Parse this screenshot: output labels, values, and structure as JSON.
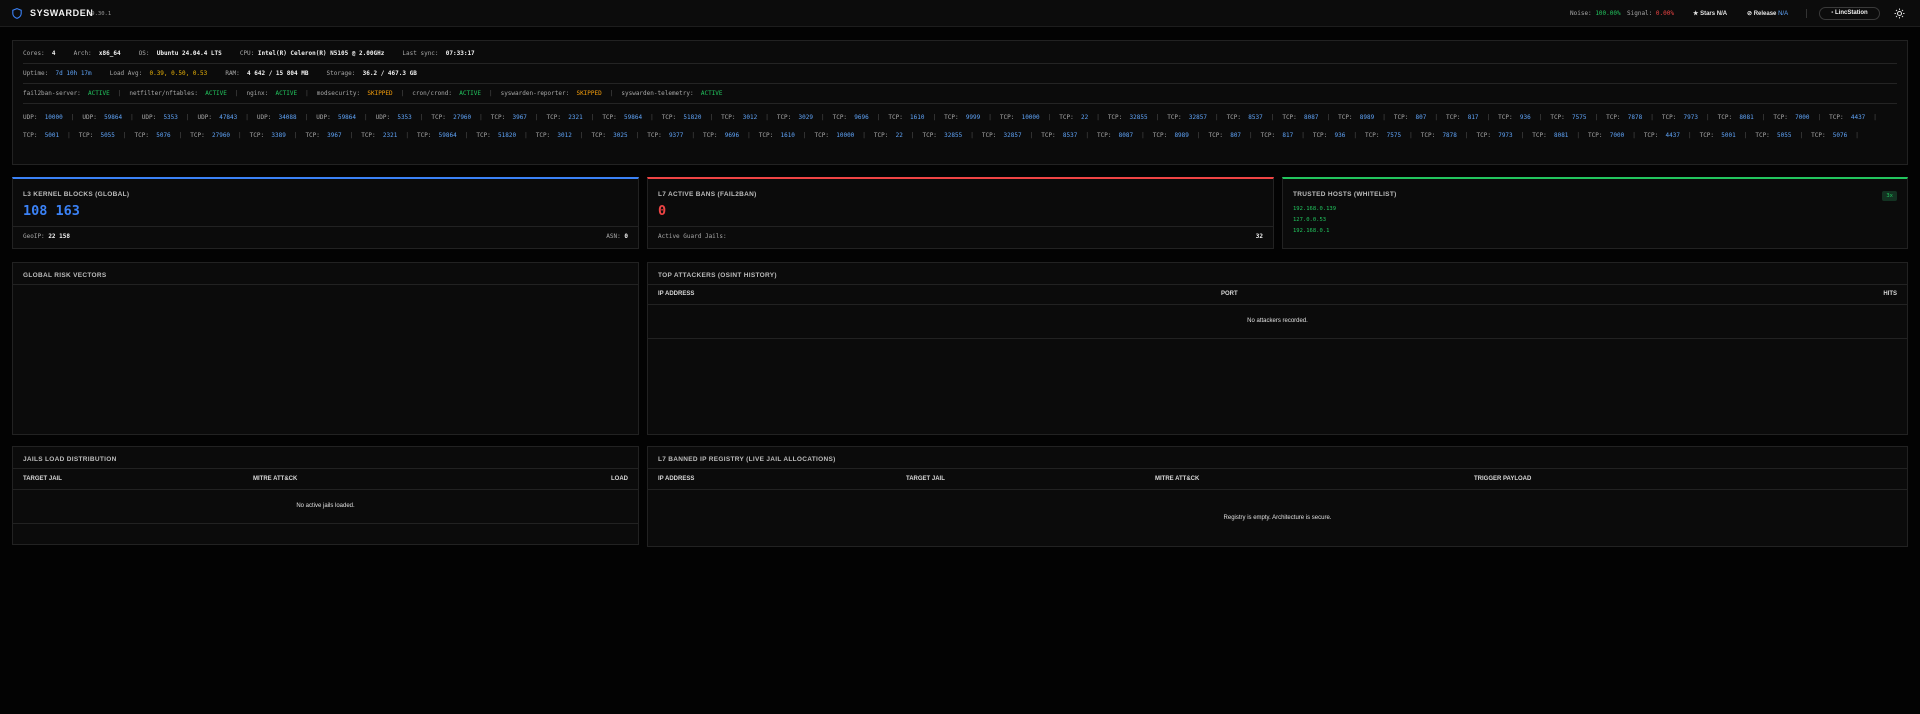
{
  "header": {
    "brand": "SYSWARDEN",
    "version": "v9.30.1",
    "noise_label": "Noise:",
    "noise_value": "100.00%",
    "signal_label": "Signal:",
    "signal_value": "0.00%",
    "stars_label": "Stars",
    "stars_value": "N/A",
    "release_label": "Release",
    "release_value": "N/A",
    "station_button": "LincStation",
    "colors": {
      "accent": "#60a5fa",
      "ok": "#22c55e",
      "danger": "#ef4444",
      "warn": "#f59e0b"
    }
  },
  "system": {
    "cores_label": "Cores:",
    "cores": "4",
    "arch_label": "Arch:",
    "arch": "x86_64",
    "os_label": "OS:",
    "os": "Ubuntu 24.04.4 LTS",
    "cpu_label": "CPU:",
    "cpu": "Intel(R) Celeron(R) N5105 @ 2.00GHz",
    "sync_label": "Last sync:",
    "sync": "07:33:17",
    "uptime_label": "Uptime:",
    "uptime": "7d 10h 17m",
    "load_label": "Load Avg:",
    "load": "0.39, 0.50, 0.53",
    "ram_label": "RAM:",
    "ram": "4 642 / 15 804 MB",
    "storage_label": "Storage:",
    "storage": "36.2 / 467.3 GB",
    "services": [
      {
        "name": "fail2ban-server:",
        "status": "ACTIVE"
      },
      {
        "name": "netfilter/nftables:",
        "status": "ACTIVE"
      },
      {
        "name": "nginx:",
        "status": "ACTIVE"
      },
      {
        "name": "modsecurity:",
        "status": "SKIPPED"
      },
      {
        "name": "cron/crond:",
        "status": "ACTIVE"
      },
      {
        "name": "syswarden-reporter:",
        "status": "SKIPPED"
      },
      {
        "name": "syswarden-telemetry:",
        "status": "ACTIVE"
      }
    ],
    "ports": [
      [
        "UDP:",
        "10000"
      ],
      [
        "UDP:",
        "59864"
      ],
      [
        "UDP:",
        "5353"
      ],
      [
        "UDP:",
        "47843"
      ],
      [
        "UDP:",
        "34088"
      ],
      [
        "UDP:",
        "59864"
      ],
      [
        "UDP:",
        "5353"
      ],
      [
        "TCP:",
        "27960"
      ],
      [
        "TCP:",
        "3967"
      ],
      [
        "TCP:",
        "2321"
      ],
      [
        "TCP:",
        "59864"
      ],
      [
        "TCP:",
        "51820"
      ],
      [
        "TCP:",
        "3012"
      ],
      [
        "TCP:",
        "3029"
      ],
      [
        "TCP:",
        "9696"
      ],
      [
        "TCP:",
        "1610"
      ],
      [
        "TCP:",
        "9999"
      ],
      [
        "TCP:",
        "10000"
      ],
      [
        "TCP:",
        "22"
      ],
      [
        "TCP:",
        "32855"
      ],
      [
        "TCP:",
        "32857"
      ],
      [
        "TCP:",
        "8537"
      ],
      [
        "TCP:",
        "8087"
      ],
      [
        "TCP:",
        "8989"
      ],
      [
        "TCP:",
        "807"
      ],
      [
        "TCP:",
        "817"
      ],
      [
        "TCP:",
        "936"
      ],
      [
        "TCP:",
        "7575"
      ],
      [
        "TCP:",
        "7878"
      ],
      [
        "TCP:",
        "7973"
      ],
      [
        "TCP:",
        "8081"
      ],
      [
        "TCP:",
        "7000"
      ],
      [
        "TCP:",
        "4437"
      ],
      [
        "TCP:",
        "5001"
      ],
      [
        "TCP:",
        "5055"
      ],
      [
        "TCP:",
        "5076"
      ],
      [
        "TCP:",
        "27960"
      ],
      [
        "TCP:",
        "3389"
      ],
      [
        "TCP:",
        "3967"
      ],
      [
        "TCP:",
        "2321"
      ],
      [
        "TCP:",
        "59864"
      ],
      [
        "TCP:",
        "51820"
      ],
      [
        "TCP:",
        "3012"
      ],
      [
        "TCP:",
        "3025"
      ],
      [
        "TCP:",
        "9377"
      ],
      [
        "TCP:",
        "9696"
      ],
      [
        "TCP:",
        "1610"
      ],
      [
        "TCP:",
        "10000"
      ],
      [
        "TCP:",
        "22"
      ],
      [
        "TCP:",
        "32855"
      ],
      [
        "TCP:",
        "32857"
      ],
      [
        "TCP:",
        "8537"
      ],
      [
        "TCP:",
        "8087"
      ],
      [
        "TCP:",
        "8989"
      ],
      [
        "TCP:",
        "807"
      ],
      [
        "TCP:",
        "817"
      ],
      [
        "TCP:",
        "936"
      ],
      [
        "TCP:",
        "7575"
      ],
      [
        "TCP:",
        "7878"
      ],
      [
        "TCP:",
        "7973"
      ],
      [
        "TCP:",
        "8081"
      ],
      [
        "TCP:",
        "7000"
      ],
      [
        "TCP:",
        "4437"
      ],
      [
        "TCP:",
        "5001"
      ],
      [
        "TCP:",
        "5055"
      ],
      [
        "TCP:",
        "5076"
      ]
    ]
  },
  "cards": {
    "l3": {
      "title": "L3 KERNEL BLOCKS (GLOBAL)",
      "value": "108 163",
      "geoip_label": "GeoIP:",
      "geoip": "22 158",
      "asn_label": "ASN:",
      "asn": "0",
      "color": "#3b82f6"
    },
    "l7": {
      "title": "L7 ACTIVE BANS (FAIL2BAN)",
      "value": "0",
      "jails_label": "Active Guard Jails:",
      "jails": "32",
      "color": "#ef4444"
    },
    "trusted": {
      "title": "TRUSTED HOSTS (WHITELIST)",
      "badge": "3x",
      "hosts": [
        "192.168.0.139",
        "127.0.0.53",
        "192.168.0.1"
      ],
      "color": "#22c55e"
    }
  },
  "risk": {
    "title": "GLOBAL RISK VECTORS"
  },
  "attackers": {
    "title": "TOP ATTACKERS (OSINT HISTORY)",
    "col_ip": "IP ADDRESS",
    "col_port": "PORT",
    "col_hits": "HITS",
    "empty": "No attackers recorded."
  },
  "jails": {
    "title": "JAILS LOAD DISTRIBUTION",
    "col_jail": "TARGET JAIL",
    "col_mitre": "MITRE ATT&CK",
    "col_load": "LOAD",
    "empty": "No active jails loaded."
  },
  "registry": {
    "title": "L7 BANNED IP REGISTRY (LIVE JAIL ALLOCATIONS)",
    "col_ip": "IP ADDRESS",
    "col_jail": "TARGET JAIL",
    "col_mitre": "MITRE ATT&CK",
    "col_payload": "TRIGGER PAYLOAD",
    "empty": "Registry is empty. Architecture is secure."
  }
}
